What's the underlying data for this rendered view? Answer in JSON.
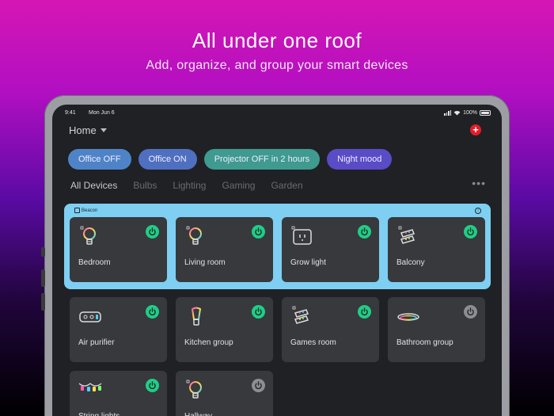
{
  "headline": "All under one roof",
  "subline": "Add, organize, and group your smart devices",
  "status_bar": {
    "time": "9:41",
    "date": "Mon Jun 6",
    "battery": "100%"
  },
  "home": {
    "title": "Home"
  },
  "scenes": [
    {
      "label": "Office OFF",
      "color": "#4f83c7"
    },
    {
      "label": "Office ON",
      "color": "#4f6fc0"
    },
    {
      "label": "Projector OFF in 2 hours",
      "color": "#3f9a8f"
    },
    {
      "label": "Night mood",
      "color": "#5a4bc7"
    }
  ],
  "tabs": [
    "All Devices",
    "Bulbs",
    "Lighting",
    "Gaming",
    "Garden"
  ],
  "tabs_more": "•••",
  "group": {
    "name": "Beacon"
  },
  "devices": [
    {
      "label": "Bedroom",
      "icon": "bulb-icon",
      "power": "on"
    },
    {
      "label": "Living room",
      "icon": "bulb-icon",
      "power": "on"
    },
    {
      "label": "Grow light",
      "icon": "plug-icon",
      "power": "on"
    },
    {
      "label": "Balcony",
      "icon": "lightstrip-icon",
      "power": "on"
    },
    {
      "label": "Air purifier",
      "icon": "air-purifier-icon",
      "power": "on"
    },
    {
      "label": "Kitchen group",
      "icon": "filament-bulb-icon",
      "power": "on"
    },
    {
      "label": "Games room",
      "icon": "lightstrip-icon",
      "power": "on"
    },
    {
      "label": "Bathroom group",
      "icon": "ring-light-icon",
      "power": "off"
    },
    {
      "label": "String lights",
      "icon": "string-lights-icon",
      "power": "on"
    },
    {
      "label": "Hallway",
      "icon": "bulb-icon",
      "power": "off"
    }
  ],
  "colors": {
    "power_on": "#1ecf87",
    "power_off": "#8d8e91",
    "group_bg": "#7ecff2",
    "add": "#e11d2b"
  }
}
